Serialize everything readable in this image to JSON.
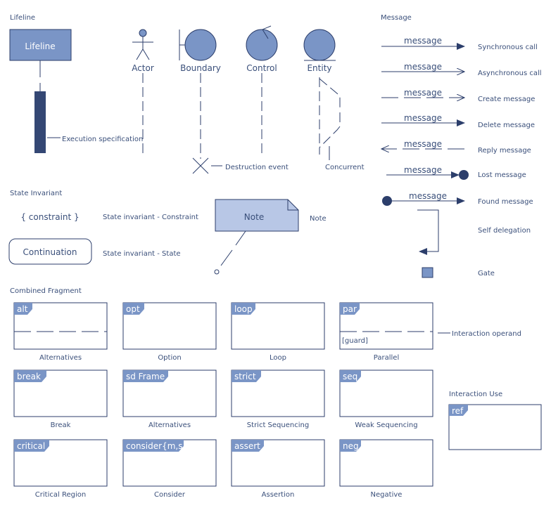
{
  "colors": {
    "stroke": "#2c3e6b",
    "fill": "#7a95c6",
    "note_fill": "#b8c7e6",
    "exec_fill": "#344774",
    "text": "#3a4f7a",
    "white_text": "#ffffff"
  },
  "sections": {
    "lifeline": "Lifeline",
    "message": "Message",
    "state_invariant": "State Invariant",
    "combined_fragment": "Combined Fragment",
    "interaction_use": "Interaction Use"
  },
  "lifeline": {
    "box_label": "Lifeline",
    "execution_spec": "Execution specification",
    "actor": "Actor",
    "boundary": "Boundary",
    "control": "Control",
    "entity": "Entity",
    "destruction_event": "Destruction event",
    "concurrent": "Concurrent"
  },
  "messages": [
    {
      "label": "message",
      "desc": "Synchronous call",
      "icon": "filled-arrow"
    },
    {
      "label": "message",
      "desc": "Asynchronous call",
      "icon": "open-arrow"
    },
    {
      "label": "message",
      "desc": "Create message",
      "icon": "dashed-open-arrow"
    },
    {
      "label": "message",
      "desc": "Delete message",
      "icon": "filled-arrow"
    },
    {
      "label": "message",
      "desc": "Reply message",
      "icon": "dashed-open-arrow-left"
    },
    {
      "label": "message",
      "desc": "Lost message",
      "icon": "arrow-to-dot"
    },
    {
      "label": "message",
      "desc": "Found message",
      "icon": "dot-to-arrow"
    }
  ],
  "self_delegation": "Self delegation",
  "gate": "Gate",
  "state_invariant": {
    "constraint": "{ constraint }",
    "constraint_desc": "State invariant - Constraint",
    "continuation": "Continuation",
    "state_desc": "State invariant - State"
  },
  "note": {
    "box_label": "Note",
    "desc": "Note"
  },
  "interaction_operand": "Interaction operand",
  "fragments": [
    {
      "tag": "alt",
      "caption": "Alternatives",
      "divider": true,
      "guard": ""
    },
    {
      "tag": "opt",
      "caption": "Option",
      "divider": false,
      "guard": ""
    },
    {
      "tag": "loop",
      "caption": "Loop",
      "divider": false,
      "guard": ""
    },
    {
      "tag": "par",
      "caption": "Parallel",
      "divider": true,
      "guard": "[guard]"
    },
    {
      "tag": "break",
      "caption": "Break",
      "divider": false,
      "guard": ""
    },
    {
      "tag": "sd Frame",
      "caption": "Alternatives",
      "divider": false,
      "guard": ""
    },
    {
      "tag": "strict",
      "caption": "Strict Sequencing",
      "divider": false,
      "guard": ""
    },
    {
      "tag": "seq",
      "caption": "Weak Sequencing",
      "divider": false,
      "guard": ""
    },
    {
      "tag": "critical",
      "caption": "Critical Region",
      "divider": false,
      "guard": ""
    },
    {
      "tag": "consider{m,s}",
      "caption": "Consider",
      "divider": false,
      "guard": ""
    },
    {
      "tag": "assert",
      "caption": "Assertion",
      "divider": false,
      "guard": ""
    },
    {
      "tag": "neg",
      "caption": "Negative",
      "divider": false,
      "guard": ""
    }
  ],
  "interaction_use": {
    "tag": "ref"
  }
}
